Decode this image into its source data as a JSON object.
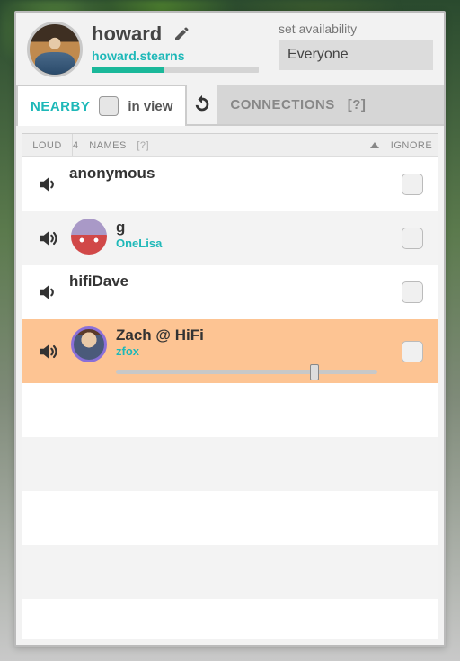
{
  "header": {
    "display_name": "howard",
    "username": "howard.stearns",
    "talk_level_pct": 43
  },
  "availability": {
    "label": "set availability",
    "value": "Everyone"
  },
  "tabs": {
    "nearby": "NEARBY",
    "in_view_label": "in view",
    "connections": "CONNECTIONS",
    "help": "[?]"
  },
  "columns": {
    "loud": "LOUD",
    "names_count": 4,
    "names_label": "NAMES",
    "names_help": "[?]",
    "ignore": "IGNORE"
  },
  "people": [
    {
      "display": "anonymous",
      "username": "",
      "has_avatar": false,
      "avatar_class": "",
      "selected": false,
      "speaker_waves": 1
    },
    {
      "display": "g",
      "username": "OneLisa",
      "has_avatar": true,
      "avatar_class": "av-g",
      "selected": false,
      "speaker_waves": 2
    },
    {
      "display": "hifiDave",
      "username": "",
      "has_avatar": false,
      "avatar_class": "",
      "selected": false,
      "speaker_waves": 1
    },
    {
      "display": "Zach @ HiFi",
      "username": "zfox",
      "has_avatar": true,
      "avatar_class": "av-z",
      "selected": true,
      "speaker_waves": 2,
      "slider_pct": 74
    }
  ],
  "icons": {
    "edit": "pencil-icon",
    "refresh": "refresh-icon",
    "speaker": "speaker-icon"
  }
}
